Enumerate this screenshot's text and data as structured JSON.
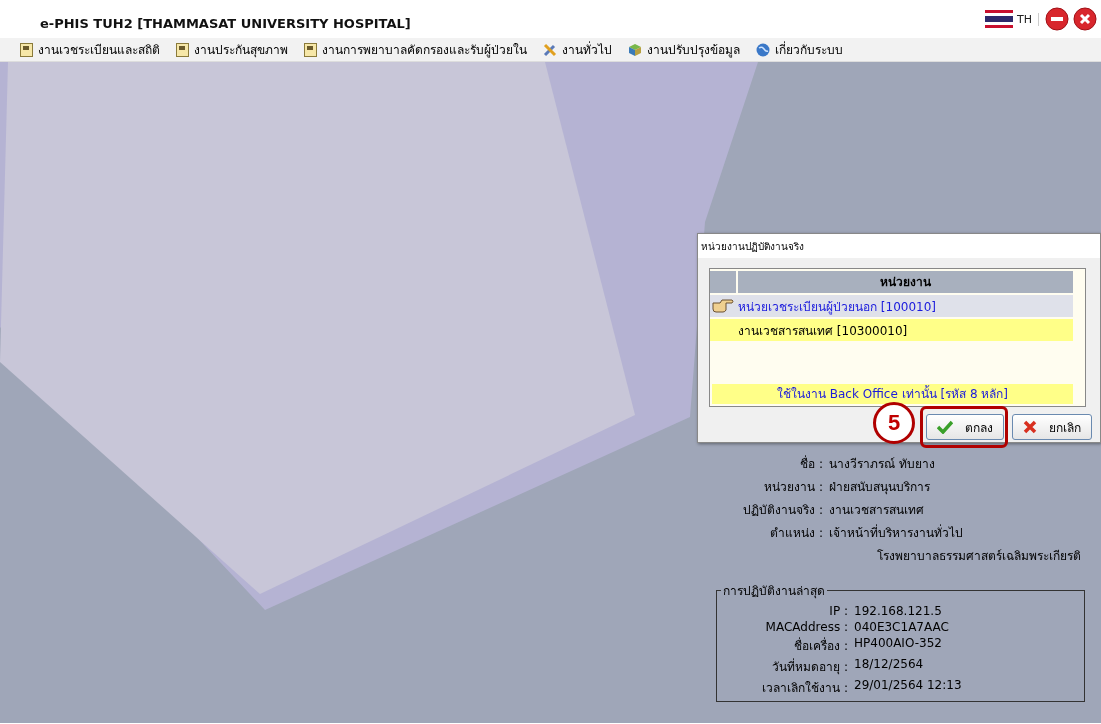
{
  "window": {
    "title": "e-PHIS TUH2 [THAMMASAT UNIVERSITY HOSPITAL]",
    "language": "TH"
  },
  "menu": [
    {
      "label": "งานเวชระเบียนและสถิติ",
      "kind": "module"
    },
    {
      "label": "งานประกันสุขภาพ",
      "kind": "module"
    },
    {
      "label": "งานการพยาบาลคัดกรองและรับผู้ป่วยใน",
      "kind": "module"
    },
    {
      "label": "งานทั่วไป",
      "kind": "tools"
    },
    {
      "label": "งานปรับปรุงข้อมูล",
      "kind": "update"
    },
    {
      "label": "เกี่ยวกับระบบ",
      "kind": "about"
    }
  ],
  "dialog": {
    "title": "หน่วยงานปฏิบัติงานจริง",
    "column": "หน่วยงาน",
    "rows": [
      {
        "text": "หน่วยเวชระเบียนผู้ป่วยนอก [100010]",
        "selected": true,
        "highlighted": false
      },
      {
        "text": "งานเวชสารสนเทศ [10300010]",
        "selected": false,
        "highlighted": true
      }
    ],
    "note": "ใช้ในงาน Back Office เท่านั้น [รหัส 8 หลัก]",
    "buttons": [
      {
        "label": "ตกลง",
        "kind": "ok",
        "annotated": true
      },
      {
        "label": "ยกเลิก",
        "kind": "cancel",
        "annotated": false
      }
    ],
    "annotation": {
      "step": "5"
    }
  },
  "user": {
    "fields": [
      {
        "label": "ชื่อ :",
        "value": "นางวีราภรณ์  ทับยาง"
      },
      {
        "label": "หน่วยงาน :",
        "value": "ฝ่ายสนับสนุนบริการ"
      },
      {
        "label": "ปฏิบัติงานจริง :",
        "value": "งานเวชสารสนเทศ"
      },
      {
        "label": "ตำแหน่ง :",
        "value": "เจ้าหน้าที่บริหารงานทั่วไป"
      }
    ],
    "hospital": "โรงพยาบาลธรรมศาสตร์เฉลิมพระเกียรติ"
  },
  "last_session": {
    "title": "การปฏิบัติงานล่าสุด",
    "fields": [
      {
        "label": "IP :",
        "value": "192.168.121.5"
      },
      {
        "label": "MACAddress :",
        "value": "040E3C1A7AAC"
      },
      {
        "label": "ชื่อเครื่อง :",
        "value": "HP400AIO-352"
      },
      {
        "label": "วันที่หมดอายุ :",
        "value": "18/12/2564"
      },
      {
        "label": "เวลาเลิกใช้งาน :",
        "value": "29/01/2564  12:13"
      }
    ]
  }
}
